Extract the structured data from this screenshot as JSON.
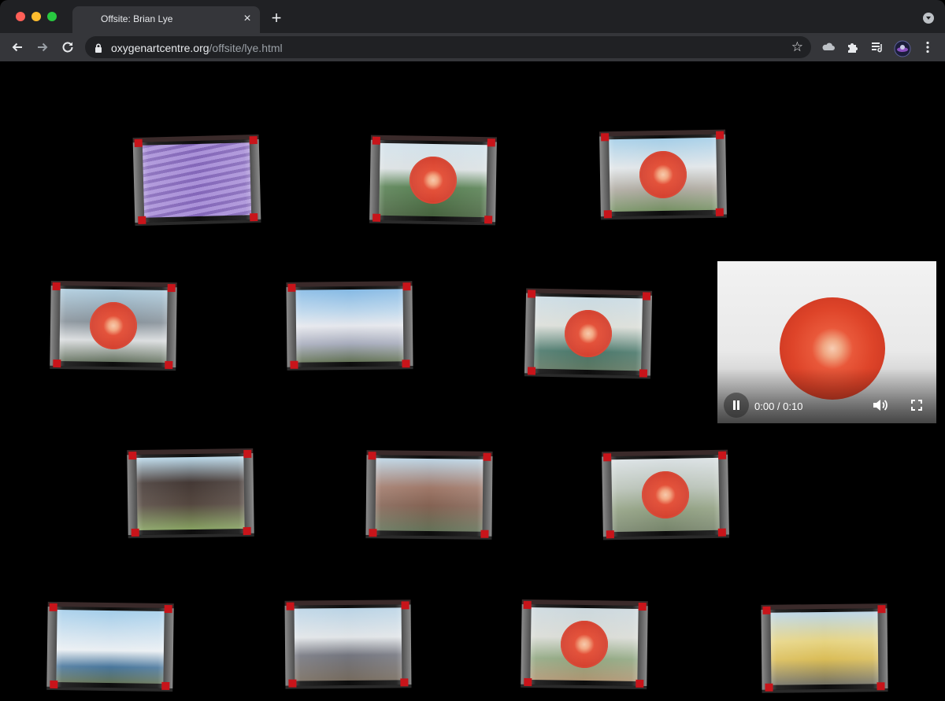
{
  "browser": {
    "tab": {
      "title": "Offsite: Brian Lye",
      "close_glyph": "×"
    },
    "new_tab_glyph": "+",
    "address": {
      "host": "oxygenartcentre.org",
      "path": "/offsite/lye.html"
    },
    "icons": {
      "back": "back-arrow-icon",
      "forward": "forward-arrow-icon",
      "reload": "reload-icon",
      "lock": "lock-icon",
      "bookmark": "star-icon",
      "extension1": "cloud-extension-icon",
      "extensions": "puzzle-icon",
      "media": "media-queue-icon",
      "profile": "profile-avatar",
      "menu": "kebab-menu-icon"
    }
  },
  "gallery": {
    "frames": [
      {
        "id": "frame-1",
        "scene": "purple-siding",
        "tomato": false
      },
      {
        "id": "frame-2",
        "scene": "garden-house",
        "tomato": true
      },
      {
        "id": "frame-3",
        "scene": "street-house",
        "tomato": true
      },
      {
        "id": "frame-4",
        "scene": "modern-house",
        "tomato": true
      },
      {
        "id": "frame-5",
        "scene": "bungalow",
        "tomato": false
      },
      {
        "id": "frame-6",
        "scene": "porch-house",
        "tomato": true
      },
      {
        "id": "frame-7",
        "scene": "dark-gable-house",
        "tomato": false
      },
      {
        "id": "frame-8",
        "scene": "brick-house",
        "tomato": false
      },
      {
        "id": "frame-9",
        "scene": "tree-house",
        "tomato": true
      },
      {
        "id": "frame-10",
        "scene": "white-house",
        "tomato": false
      },
      {
        "id": "frame-11",
        "scene": "gable-house",
        "tomato": false
      },
      {
        "id": "frame-12",
        "scene": "victorian-house",
        "tomato": true
      },
      {
        "id": "frame-13",
        "scene": "yellow-house",
        "tomato": false
      }
    ]
  },
  "video": {
    "time": "0:00 / 0:10",
    "state": "playing",
    "icons": {
      "pause": "pause-icon",
      "volume": "volume-icon",
      "fullscreen": "fullscreen-icon"
    }
  },
  "colors": {
    "chrome_dark": "#202124",
    "chrome_toolbar": "#35363a",
    "page_background": "#000000",
    "tape_red": "#c8141a",
    "tomato_red": "#d53a26"
  }
}
